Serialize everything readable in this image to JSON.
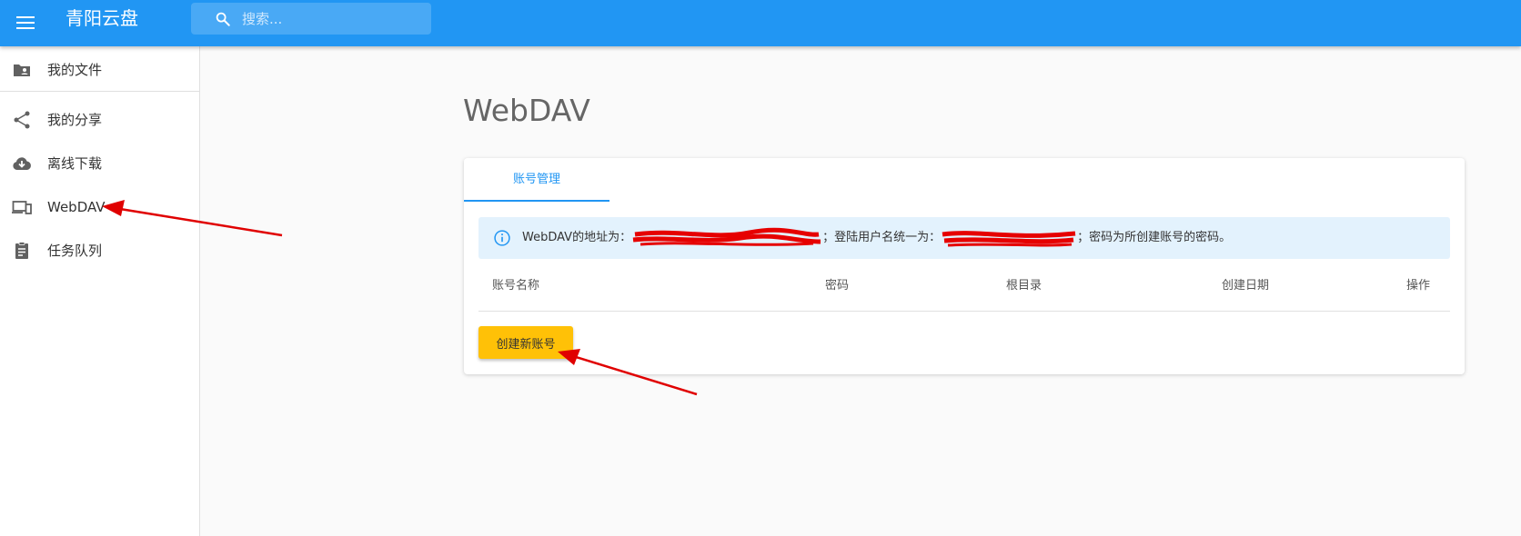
{
  "app": {
    "title": "青阳云盘"
  },
  "search": {
    "placeholder": "搜索..."
  },
  "sidebar": {
    "items": [
      {
        "label": "我的文件",
        "icon": "folder-account-icon"
      },
      {
        "label": "我的分享",
        "icon": "share-icon"
      },
      {
        "label": "离线下载",
        "icon": "cloud-download-icon"
      },
      {
        "label": "WebDAV",
        "icon": "devices-icon"
      },
      {
        "label": "任务队列",
        "icon": "clipboard-list-icon"
      }
    ]
  },
  "page": {
    "title": "WebDAV"
  },
  "tabs": [
    {
      "label": "账号管理",
      "active": true
    }
  ],
  "alert": {
    "prefix": "WebDAV的地址为：",
    "mid": "；登陆用户名统一为：",
    "suffix": "；密码为所创建账号的密码。"
  },
  "table": {
    "headers": [
      "账号名称",
      "密码",
      "根目录",
      "创建日期",
      "操作"
    ]
  },
  "actions": {
    "create_label": "创建新账号"
  },
  "colors": {
    "primary": "#2196f3",
    "accent": "#ffc107",
    "info_bg": "#e3f2fd",
    "annotation": "#e00000"
  }
}
